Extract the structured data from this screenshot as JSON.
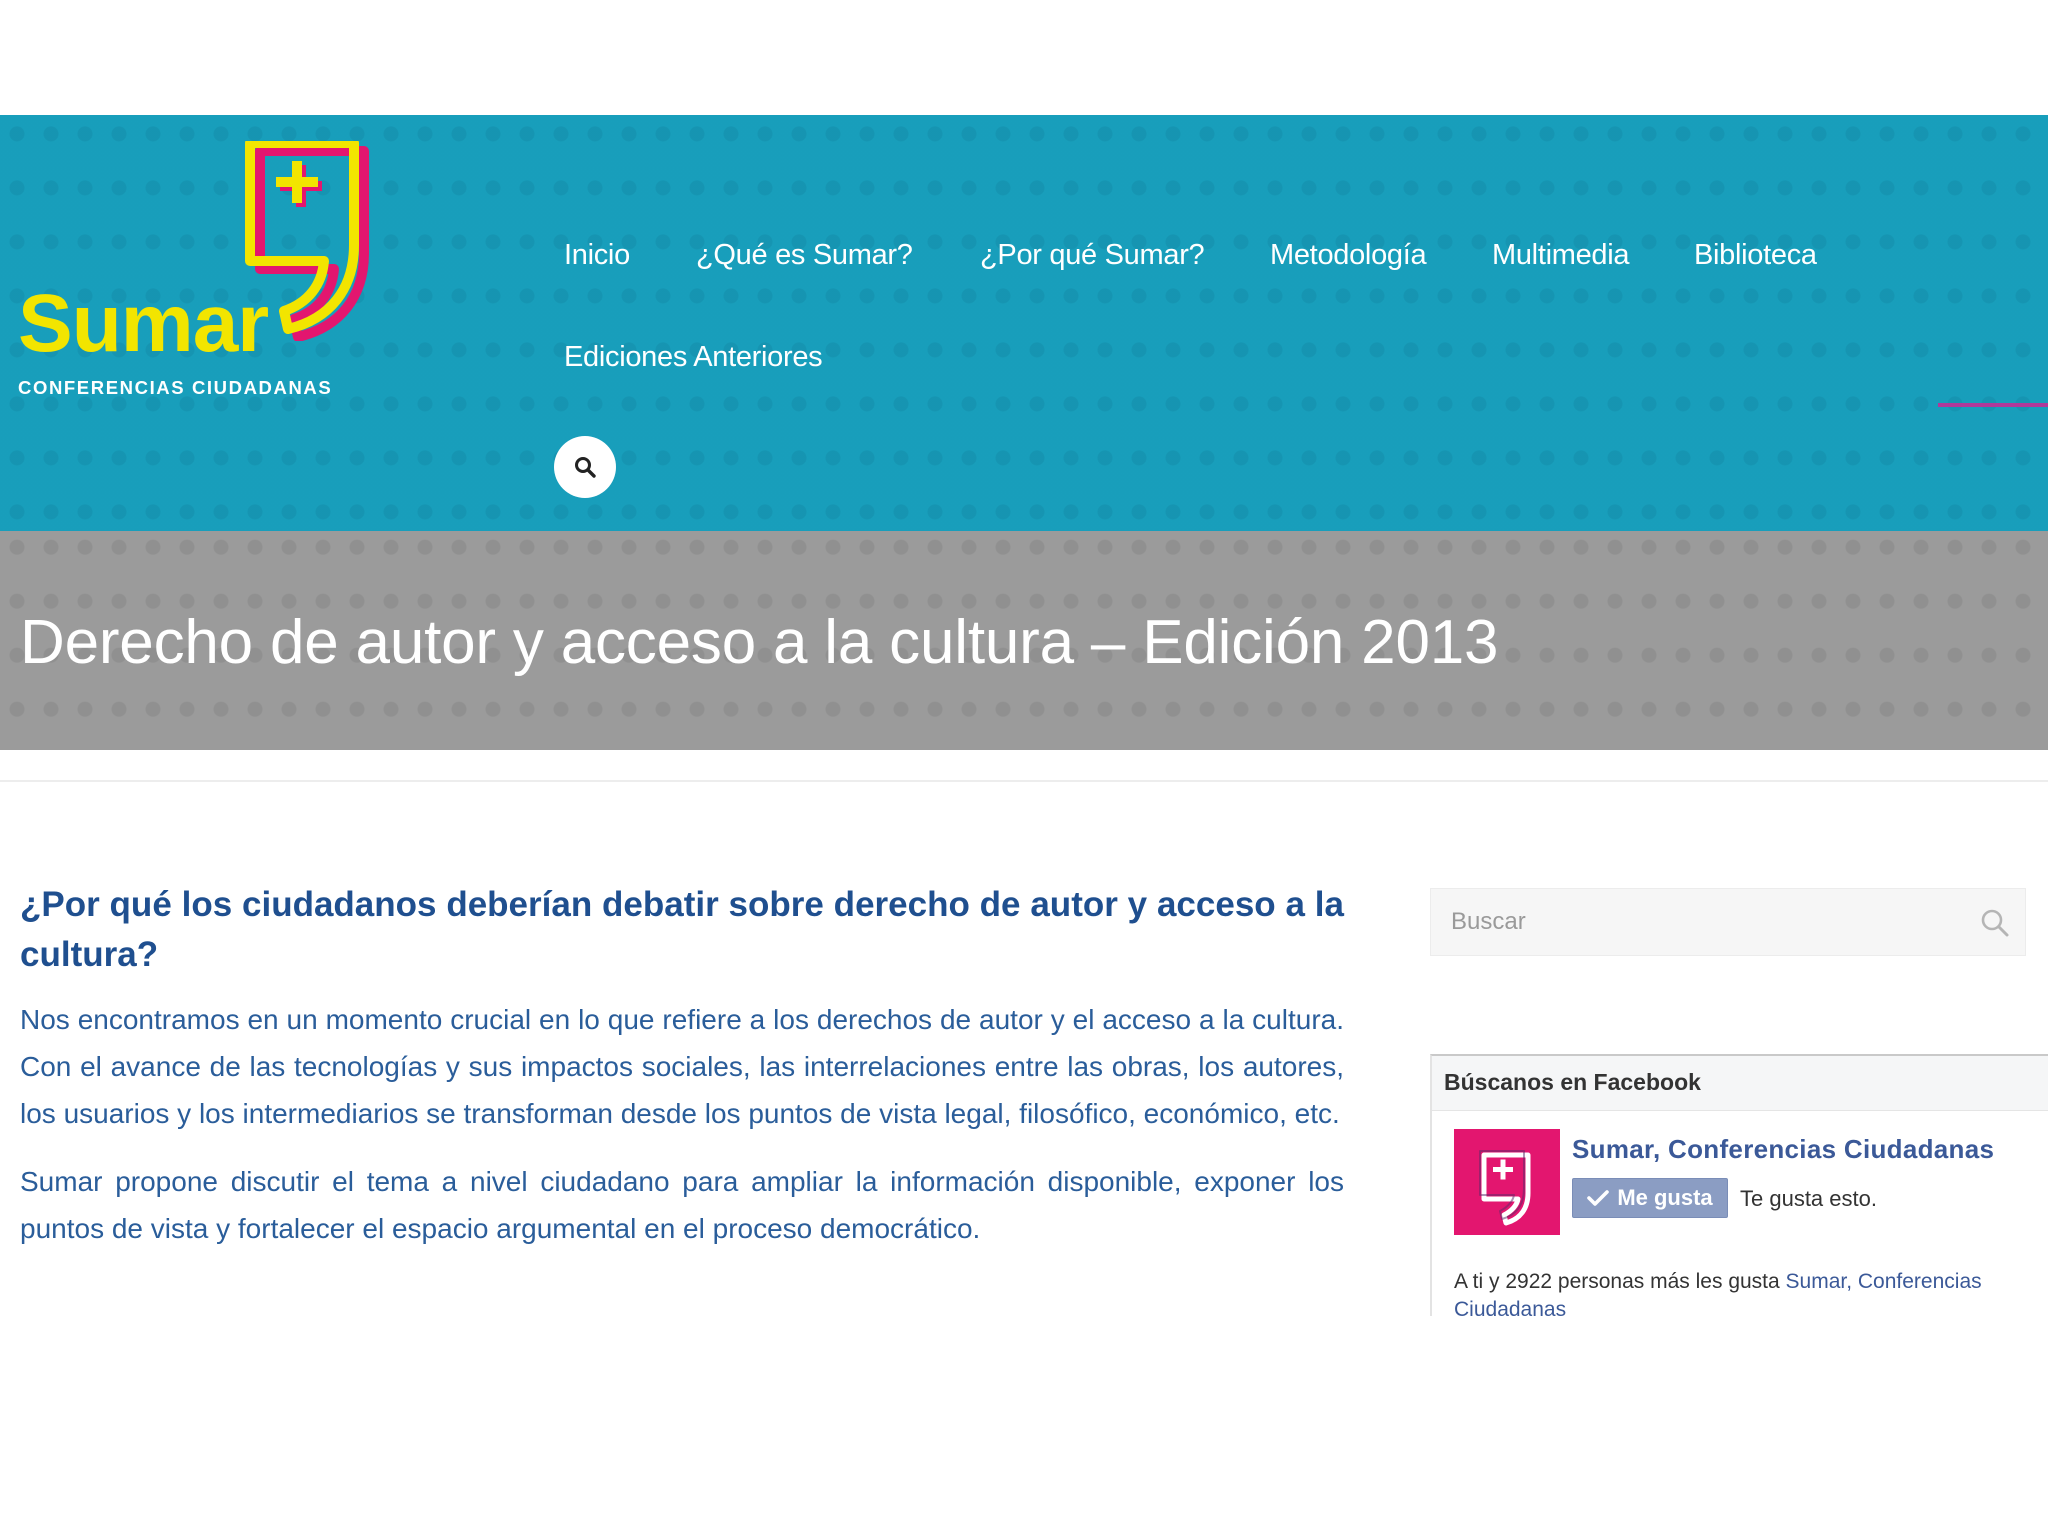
{
  "brand": {
    "name": "Sumar",
    "tagline": "CONFERENCIAS CIUDADANAS",
    "colors": {
      "header_bg": "#1aa5c1",
      "logo_yellow": "#f2e500",
      "logo_magenta": "#e3166f",
      "title_band_bg": "#9b9b9b",
      "heading_blue": "#1f4f8f",
      "body_blue": "#2a5d9a",
      "facebook_blue": "#3b5998"
    }
  },
  "nav": {
    "items": [
      {
        "label": "Inicio"
      },
      {
        "label": "¿Qué es Sumar?"
      },
      {
        "label": "¿Por qué Sumar?"
      },
      {
        "label": "Metodología"
      },
      {
        "label": "Multimedia"
      },
      {
        "label": "Biblioteca"
      },
      {
        "label": "Ediciones Anteriores"
      }
    ],
    "search_icon": "search-icon"
  },
  "page": {
    "title": "Derecho de autor y acceso a la cultura – Edición 2013"
  },
  "article": {
    "heading": "¿Por qué los ciudadanos deberían debatir sobre derecho de autor y acceso a la cultura?",
    "paragraphs": [
      "Nos encontramos en un momento crucial en lo que refiere a los derechos de autor y el acceso a la cultura. Con el avance de las tecnologías y sus impactos sociales, las interrelaciones entre las obras, los autores, los usuarios y los intermediarios se transforman desde los puntos de vista legal, filosófico, económico, etc.",
      "Sumar propone discutir el tema a nivel ciudadano para ampliar la información disponible, exponer los puntos de vista y fortalecer el espacio argumental en el proceso democrático."
    ]
  },
  "sidebar": {
    "search": {
      "placeholder": "Buscar",
      "value": ""
    },
    "facebook": {
      "title": "Búscanos en Facebook",
      "page_name": "Sumar, Conferencias Ciudadanas",
      "like_button": "Me gusta",
      "like_status": "Te gusta esto.",
      "summary_prefix": "A ti y 2922 personas más les gusta ",
      "summary_link": "Sumar, Conferencias Ciudadanas"
    }
  }
}
